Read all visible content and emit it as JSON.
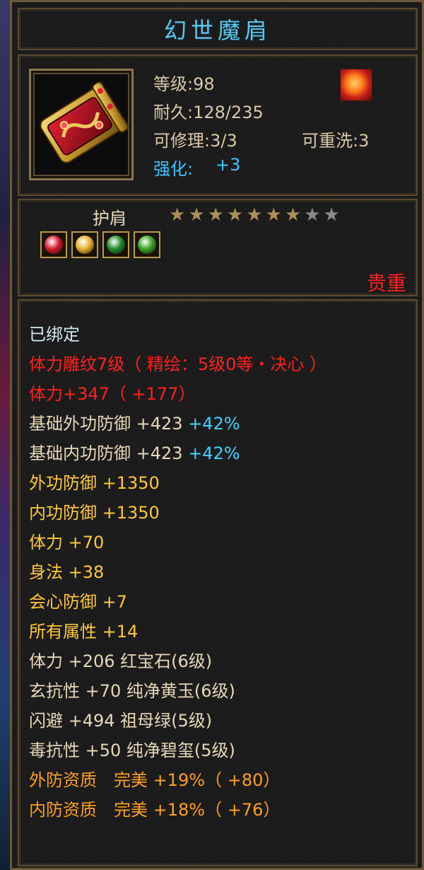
{
  "item": {
    "name": "幻世魔肩",
    "level": "等级:98",
    "durability": "耐久:128/235",
    "repair": "可修理:3/3",
    "rewash": "可重洗:3",
    "enhance_label": "强化:",
    "enhance_value": "+3",
    "slot": "护肩",
    "stars_lit": 7,
    "stars_total": 9,
    "quality": "贵重"
  },
  "colors": {
    "title": "#5fc6e8",
    "bound": "#d0e8f0",
    "red": "#ff2020",
    "tan": "#e8d8b8",
    "cyan": "#3fd3ff",
    "gold": "#ffc83a",
    "orange": "#ffa020"
  },
  "gems": [
    {
      "name": "red-gem-icon",
      "color": "#d21a2a"
    },
    {
      "name": "yellow-gem-icon",
      "color": "#e8b030"
    },
    {
      "name": "green-gem-icon",
      "color": "#1e8a2a"
    },
    {
      "name": "jade-gem-icon",
      "color": "#3aa028"
    }
  ],
  "props": {
    "bound": "已绑定",
    "engrave": "体力雕纹7级（ 精绘：5级0等・决心 ）",
    "engrave_stat": "体力+347（ +177）",
    "base_outer_def": "基础外功防御 +423",
    "base_outer_def_pct": "+42%",
    "base_inner_def": "基础内功防御 +423",
    "base_inner_def_pct": "+42%",
    "outer_def": "外功防御 +1350",
    "inner_def": "内功防御 +1350",
    "stamina": "体力 +70",
    "agility": "身法 +38",
    "crit_def": "会心防御 +7",
    "all_attr": "所有属性 +14",
    "gem1": "体力 +206 红宝石(6级)",
    "gem2": "玄抗性 +70 纯净黄玉(6级)",
    "gem3": "闪避 +494 祖母绿(5级)",
    "gem4": "毒抗性 +50 纯净碧玺(5级)",
    "outer_quality": "外防资质　完美 +19%（ +80）",
    "inner_quality": "内防资质　完美 +18%（ +76）"
  }
}
